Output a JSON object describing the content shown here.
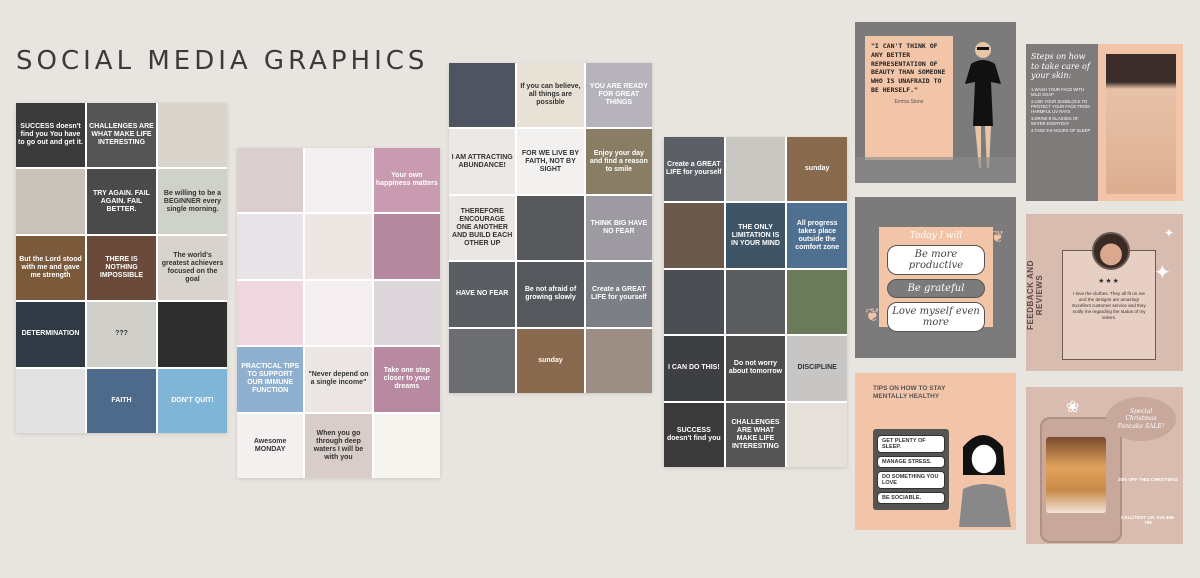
{
  "page": {
    "title": "SOCIAL MEDIA GRAPHICS"
  },
  "grid1": {
    "tiles": [
      {
        "text": "SUCCESS doesn't find you You have to go out and get it.",
        "bg": "#3a3a3a",
        "tone": "dark"
      },
      {
        "text": "CHALLENGES ARE WHAT MAKE LIFE INTERESTING",
        "bg": "#555555",
        "tone": "dark"
      },
      {
        "text": "",
        "bg": "#d9d4cc",
        "tone": "light"
      },
      {
        "text": "",
        "bg": "#c8c2b8",
        "tone": "light"
      },
      {
        "text": "TRY AGAIN. FAIL AGAIN. FAIL BETTER.",
        "bg": "#4a4a4a",
        "tone": "dark"
      },
      {
        "text": "Be willing to be a BEGINNER every single morning.",
        "bg": "#cfd2c9",
        "tone": "light"
      },
      {
        "text": "But the Lord stood with me and gave me strength",
        "bg": "#7a5a3a",
        "tone": "dark"
      },
      {
        "text": "THERE IS NOTHING IMPOSSIBLE",
        "bg": "#6a4a3a",
        "tone": "dark"
      },
      {
        "text": "The world's greatest achievers focused on the goal",
        "bg": "#d8d3cc",
        "tone": "light"
      },
      {
        "text": "DETERMINATION",
        "bg": "#2f3a44",
        "tone": "dark"
      },
      {
        "text": "???",
        "bg": "#d1cfc9",
        "tone": "light"
      },
      {
        "text": "",
        "bg": "#2d2d2d",
        "tone": "dark"
      },
      {
        "text": "",
        "bg": "#e2e2e2",
        "tone": "light"
      },
      {
        "text": "FAITH",
        "bg": "#4e6a8a",
        "tone": "dark"
      },
      {
        "text": "DON'T QUIT!",
        "bg": "#7fb6d8",
        "tone": "dark"
      }
    ]
  },
  "grid2": {
    "tiles": [
      {
        "text": "",
        "bg": "#d9cfcf",
        "tone": "light"
      },
      {
        "text": "",
        "bg": "#f3eef0",
        "tone": "light"
      },
      {
        "text": "Your own happiness matters",
        "bg": "#c89bb0",
        "tone": "dark"
      },
      {
        "text": "",
        "bg": "#e8e3e6",
        "tone": "light"
      },
      {
        "text": "",
        "bg": "#ede6e2",
        "tone": "light"
      },
      {
        "text": "",
        "bg": "#b58aa0",
        "tone": "dark"
      },
      {
        "text": "",
        "bg": "#f0d7df",
        "tone": "light"
      },
      {
        "text": "",
        "bg": "#f4eef0",
        "tone": "light"
      },
      {
        "text": "",
        "bg": "#ddd6da",
        "tone": "light"
      },
      {
        "text": "PRACTICAL TIPS TO SUPPORT OUR IMMUNE FUNCTION",
        "bg": "#8fb0cf",
        "tone": "dark"
      },
      {
        "text": "\"Never depend on a single income\"",
        "bg": "#ebe6e4",
        "tone": "light"
      },
      {
        "text": "Take one step closer to your dreams",
        "bg": "#b88aa2",
        "tone": "dark"
      },
      {
        "text": "Awesome MONDAY",
        "bg": "#f3f0ef",
        "tone": "light"
      },
      {
        "text": "When you go through deep waters I will be with you",
        "bg": "#d8cdc8",
        "tone": "light"
      },
      {
        "text": "",
        "bg": "#f6f4ef",
        "tone": "light"
      }
    ]
  },
  "grid3": {
    "tiles": [
      {
        "text": "",
        "bg": "#4f5560",
        "tone": "dark"
      },
      {
        "text": "If you can believe, all things are possible",
        "bg": "#e7e1d6",
        "tone": "light"
      },
      {
        "text": "YOU ARE READY FOR GREAT THINGS",
        "bg": "#b7b3bc",
        "tone": "dark"
      },
      {
        "text": "I AM ATTRACTING ABUNDANCE!",
        "bg": "#ebe8e5",
        "tone": "light"
      },
      {
        "text": "FOR WE LIVE BY FAITH, NOT BY SIGHT",
        "bg": "#f2f1ef",
        "tone": "light"
      },
      {
        "text": "Enjoy your day and find a reason to smile",
        "bg": "#8a7d66",
        "tone": "dark"
      },
      {
        "text": "THEREFORE ENCOURAGE ONE ANOTHER AND BUILD EACH OTHER UP",
        "bg": "#e9e6e3",
        "tone": "light"
      },
      {
        "text": "",
        "bg": "#56585c",
        "tone": "dark"
      },
      {
        "text": "THINK BIG HAVE NO FEAR",
        "bg": "#9d9aa1",
        "tone": "dark"
      },
      {
        "text": "HAVE NO FEAR",
        "bg": "#5a5e62",
        "tone": "dark"
      },
      {
        "text": "Be not afraid of growing slowly",
        "bg": "#55585c",
        "tone": "dark"
      },
      {
        "text": "Create a GREAT LIFE for yourself",
        "bg": "#7d7f86",
        "tone": "dark"
      },
      {
        "text": "",
        "bg": "#6b6d70",
        "tone": "dark"
      },
      {
        "text": "sunday",
        "bg": "#8a6a4e",
        "tone": "dark"
      },
      {
        "text": "",
        "bg": "#9c8e84",
        "tone": "dark"
      }
    ]
  },
  "grid4": {
    "tiles": [
      {
        "text": "Create a GREAT LIFE for yourself",
        "bg": "#5d5f66",
        "tone": "dark"
      },
      {
        "text": "",
        "bg": "#c9c7c2",
        "tone": "light"
      },
      {
        "text": "sunday",
        "bg": "#8a6a4e",
        "tone": "dark"
      },
      {
        "text": "",
        "bg": "#6b5a4c",
        "tone": "dark"
      },
      {
        "text": "THE ONLY LIMITATION IS IN YOUR MIND",
        "bg": "#3f5566",
        "tone": "dark"
      },
      {
        "text": "All progress takes place outside the comfort zone",
        "bg": "#4f7090",
        "tone": "dark"
      },
      {
        "text": "",
        "bg": "#4b4e52",
        "tone": "dark"
      },
      {
        "text": "",
        "bg": "#5a5c5e",
        "tone": "dark"
      },
      {
        "text": "",
        "bg": "#6b7a5a",
        "tone": "dark"
      },
      {
        "text": "I CAN DO THIS!",
        "bg": "#3d3f42",
        "tone": "dark"
      },
      {
        "text": "Do not worry about tomorrow",
        "bg": "#4e4e4e",
        "tone": "dark"
      },
      {
        "text": "DISCIPLINE",
        "bg": "#c8c6c4",
        "tone": "light"
      },
      {
        "text": "SUCCESS doesn't find you",
        "bg": "#3a3a3a",
        "tone": "dark"
      },
      {
        "text": "CHALLENGES ARE WHAT MAKE LIFE INTERESTING",
        "bg": "#555555",
        "tone": "dark"
      },
      {
        "text": "",
        "bg": "#e5e1da",
        "tone": "light"
      }
    ]
  },
  "cards": {
    "quote": {
      "text": "\"I CAN'T THINK OF ANY BETTER REPRESENTATION OF BEAUTY THAN SOMEONE WHO IS UNAFRAID TO BE HERSELF.\"",
      "author": "Emma Stone"
    },
    "skin": {
      "title": "Steps on how to take care of your skin:",
      "steps": [
        "1.WASH YOUR FACE WITH MILD SOAP",
        "2.USE YOUR SUNBLOCK TO PROTECT YOUR FACE FROM HARMFUL UV RAYS",
        "3.DRINK 8 GLASSES OF WATER EVERYDAY",
        "4.TAKE 8-9 HOURS OF SLEEP"
      ]
    },
    "today": {
      "heading": "Today I will",
      "items": [
        "Be more productive",
        "Be grateful",
        "Love myself even more"
      ]
    },
    "feedback": {
      "label": "FEEDBACK AND REVIEWS",
      "stars": "★★★",
      "review": "I love the clothes. They all fit on me and the designs are amazing! Excellent customer service and they notify me regarding the status of my orders."
    },
    "mental": {
      "title": "TIPS ON HOW TO STAY MENTALLY HEALTHY",
      "tips": [
        "GET PLENTY OF SLEEP.",
        "MANAGE STRESS.",
        "DO SOMETHING YOU LOVE",
        "BE SOCIABLE."
      ]
    },
    "promo": {
      "bubble": "Special Christmas Pancake SALE!",
      "offer": "20% OFF THIS CHRISTMAS",
      "call": "CALL/TEXT US: 023-456-789"
    }
  },
  "colors": {
    "background": "#e8e4df",
    "peach": "#f2c4a8",
    "gray": "#7b7b7b"
  }
}
